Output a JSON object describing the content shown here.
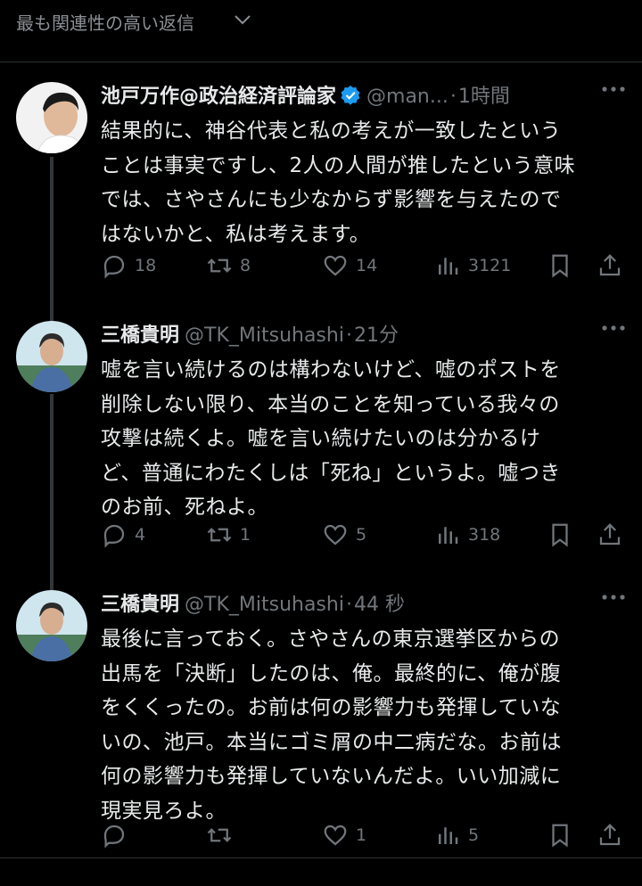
{
  "sort": {
    "label": "最も関連性の高い返信"
  },
  "tweets": [
    {
      "name": "池戸万作@政治経済評論家",
      "handle": "@man...",
      "time": "1時間",
      "verified": true,
      "lines": [
        "結果的に、神谷代表と私の考えが一致したという",
        "ことは事実ですし、2人の人間が推したという意味",
        "では、さやさんにも少なからず影響を与えたので",
        "はないかと、私は考えます。"
      ],
      "replies": "18",
      "reposts": "8",
      "likes": "14",
      "views": "3121"
    },
    {
      "name": "三橋貴明",
      "handle": "@TK_Mitsuhashi",
      "time": "21分",
      "verified": false,
      "lines": [
        "嘘を言い続けるのは構わないけど、嘘のポストを",
        "削除しない限り、本当のことを知っている我々の",
        "攻撃は続くよ。嘘を言い続けたいのは分かるけ",
        "ど、普通にわたくしは「死ね」というよ。嘘つき",
        "のお前、死ねよ。"
      ],
      "replies": "4",
      "reposts": "1",
      "likes": "5",
      "views": "318"
    },
    {
      "name": "三橋貴明",
      "handle": "@TK_Mitsuhashi",
      "time": "44 秒",
      "verified": false,
      "lines": [
        "最後に言っておく。さやさんの東京選挙区からの",
        "出馬を「決断」したのは、俺。最終的に、俺が腹",
        "をくくったの。お前は何の影響力も発揮していな",
        "いの、池戸。本当にゴミ屑の中二病だな。お前は",
        "何の影響力も発揮していないんだよ。いい加減に",
        "現実見ろよ。"
      ],
      "replies": "",
      "reposts": "",
      "likes": "1",
      "views": "5"
    }
  ],
  "colors": {
    "background": "#000000",
    "text": "#e7e9ea",
    "muted": "#71767b",
    "verified": "#1d9bf0"
  }
}
